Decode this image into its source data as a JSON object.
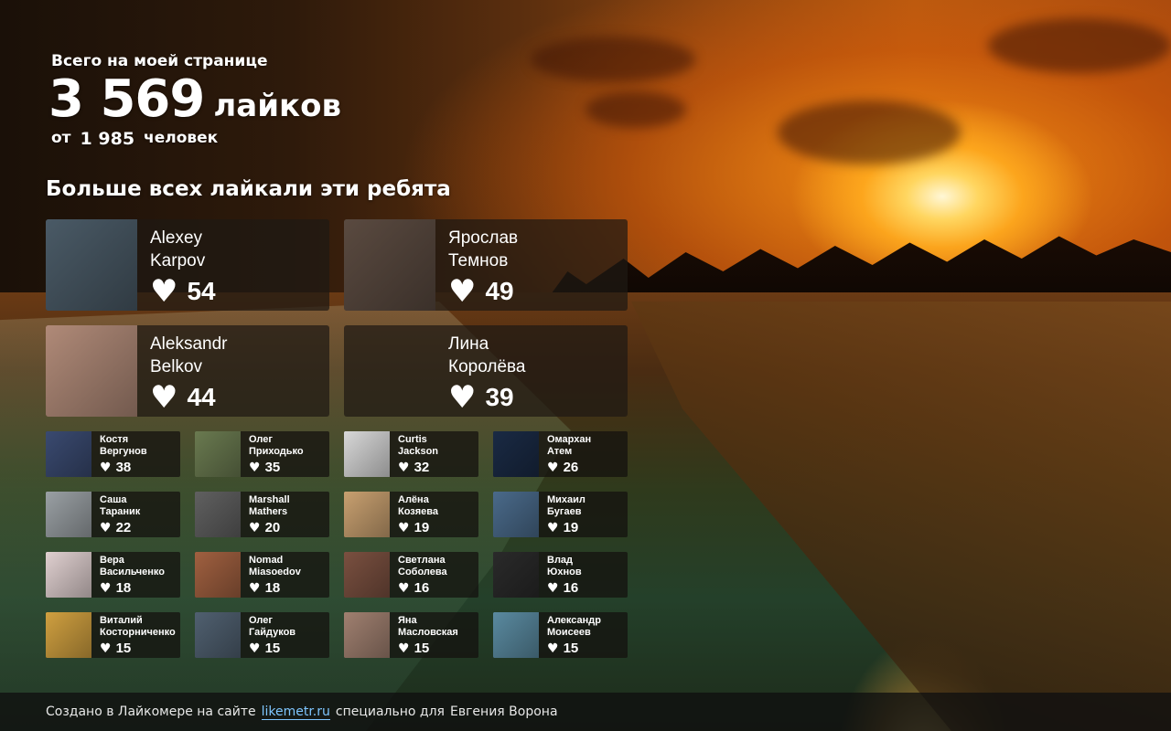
{
  "header": {
    "subtitle": "Всего на моей странице",
    "total_likes": "3 569",
    "likes_word": "лайков",
    "from_word": "от",
    "people_count": "1 985",
    "people_word": "человек"
  },
  "section_title": "Больше всех лайкали эти ребята",
  "top_fans": [
    {
      "first": "Alexey",
      "last": "Karpov",
      "likes": "54",
      "avatar_color": "#4a5a66"
    },
    {
      "first": "Ярослав",
      "last": "Темнов",
      "likes": "49",
      "avatar_color": "#5a4a40"
    },
    {
      "first": "Aleksandr",
      "last": "Belkov",
      "likes": "44",
      "avatar_color": "#b08a78"
    },
    {
      "first": "Лина",
      "last": "Королёва",
      "likes": "39",
      "avatar_color": ""
    }
  ],
  "fans": [
    {
      "first": "Костя",
      "last": "Вергунов",
      "likes": "38",
      "avatar_color": "#3a4a70"
    },
    {
      "first": "Олег",
      "last": "Приходько",
      "likes": "35",
      "avatar_color": "#6a7a50"
    },
    {
      "first": "Curtis",
      "last": "Jackson",
      "likes": "32",
      "avatar_color": "#d8d8d8"
    },
    {
      "first": "Омархан",
      "last": "Атем",
      "likes": "26",
      "avatar_color": "#1a2a44"
    },
    {
      "first": "Саша",
      "last": "Тараник",
      "likes": "22",
      "avatar_color": "#9aa0a4"
    },
    {
      "first": "Marshall",
      "last": "Mathers",
      "likes": "20",
      "avatar_color": "#606060"
    },
    {
      "first": "Алёна",
      "last": "Козяева",
      "likes": "19",
      "avatar_color": "#c8a070"
    },
    {
      "first": "Михаил",
      "last": "Бугаев",
      "likes": "19",
      "avatar_color": "#4a6a8a"
    },
    {
      "first": "Вера",
      "last": "Васильченко",
      "likes": "18",
      "avatar_color": "#e0d0d0"
    },
    {
      "first": "Nomad",
      "last": "Miasoedov",
      "likes": "18",
      "avatar_color": "#a06040"
    },
    {
      "first": "Светлана",
      "last": "Соболева",
      "likes": "16",
      "avatar_color": "#7a5040"
    },
    {
      "first": "Влад",
      "last": "Юхнов",
      "likes": "16",
      "avatar_color": "#2a2a2a"
    },
    {
      "first": "Виталий",
      "last": "Косторниченко",
      "likes": "15",
      "avatar_color": "#d0a040"
    },
    {
      "first": "Олег",
      "last": "Гайдуков",
      "likes": "15",
      "avatar_color": "#506070"
    },
    {
      "first": "Яна",
      "last": "Масловская",
      "likes": "15",
      "avatar_color": "#a08070"
    },
    {
      "first": "Александр",
      "last": "Моисеев",
      "likes": "15",
      "avatar_color": "#5a8aa0"
    }
  ],
  "footer": {
    "prefix": "Создано в Лайкомере на сайте",
    "link": "likemetr.ru",
    "middle": "специально для",
    "owner": "Евгения Ворона"
  },
  "icons": {
    "heart": "heart-icon"
  }
}
